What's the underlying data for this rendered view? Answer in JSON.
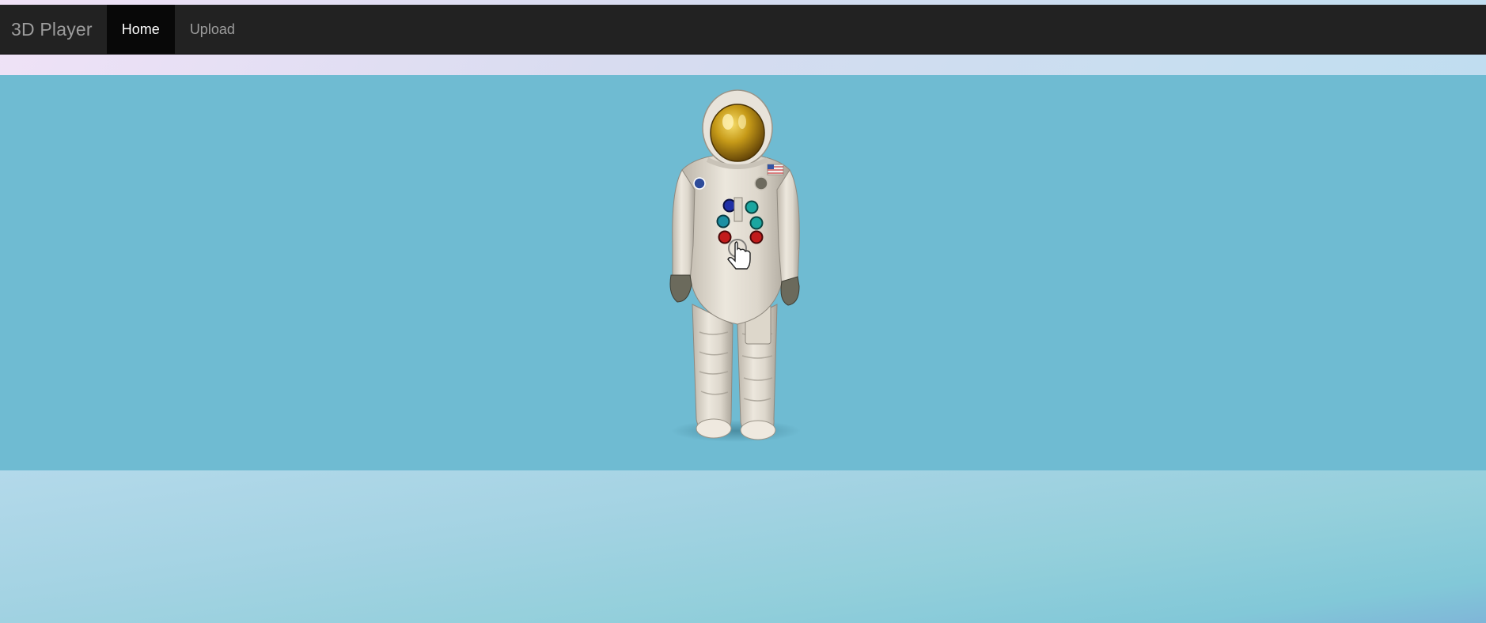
{
  "navbar": {
    "brand": "3D Player",
    "items": [
      {
        "label": "Home",
        "active": true
      },
      {
        "label": "Upload",
        "active": false
      }
    ]
  },
  "viewer": {
    "background_color": "#6fbbd2",
    "model_icon": "astronaut-model",
    "cursor_icon": "hand-pointer-icon"
  }
}
